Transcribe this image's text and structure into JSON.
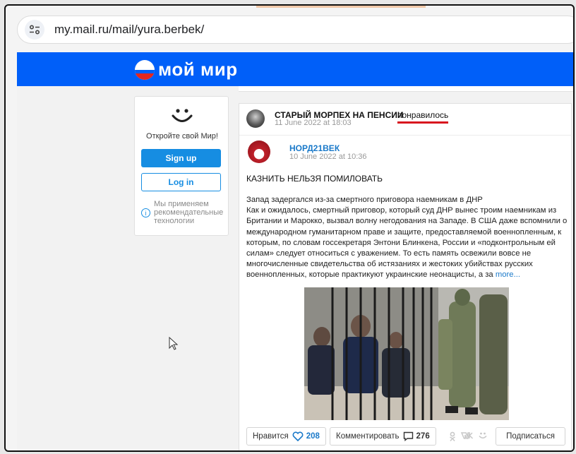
{
  "browser": {
    "url": "my.mail.ru/mail/yura.berbek/"
  },
  "brand": {
    "logo_text": "мой мир",
    "accent_color": "#005ff9"
  },
  "sidebar": {
    "invite": "Откройте свой Мир!",
    "signup_label": "Sign up",
    "login_label": "Log in",
    "info_text": "Мы применяем рекомендательные технологии"
  },
  "post": {
    "author": "СТАРЫЙ МОРПЕХ НА ПЕНСИИ",
    "action": "понравилось",
    "date": "11 June 2022 at 18:03",
    "shared": {
      "author": "НОРД21ВЕК",
      "date": "10 June 2022 at 10:36",
      "headline": "КАЗНИТЬ НЕЛЬЗЯ ПОМИЛОВАТЬ",
      "body": "Запад задергался из-за смертного приговора наемникам в ДНР Как и ожидалось, смертный приговор, который суд ДНР вынес троим наемникам из Британии и Марокко, вызвал волну негодования на Западе. В США даже вспомнили о международном гуманитарном праве и защите, предоставляемой военнопленным, к которым, по словам госсекретаря Энтони Блинкена, России и «подконтрольным ей силам» следует относиться с уважением. То есть память освежили вовсе не многочисленные свидетельства об истязаниях и жестоких убийствах русских военнопленных, которые практикуют украинские неонацисты, а за",
      "body_first_line": "Запад задергался из-за смертного приговора наемникам в ДНР",
      "body_rest": "Как и ожидалось, смертный приговор, который суд ДНР вынес троим наемникам из Британии и Марокко, вызвал волну негодования на Западе. В США даже вспомнили о международном гуманитарном праве и защите, предоставляемой военнопленным, к которым, по словам госсекретаря Энтони Блинкена, России и «подконтрольным ей силам» следует относиться с уважением. То есть память освежили вовсе не многочисленные свидетельства об истязаниях и жестоких убийствах русских военнопленных, которые практикуют украинские неонацисты, а за",
      "more_label": "more..."
    },
    "actions": {
      "like_label": "Нравится",
      "like_count": "208",
      "comment_label": "Комментировать",
      "comment_count": "276",
      "subscribe_label": "Подписаться"
    }
  },
  "icons": [
    "settings-icon",
    "smile-icon",
    "info-icon",
    "heart-icon",
    "comment-icon",
    "ok-icon",
    "vk-icon",
    "mymir-icon",
    "cursor-icon"
  ]
}
